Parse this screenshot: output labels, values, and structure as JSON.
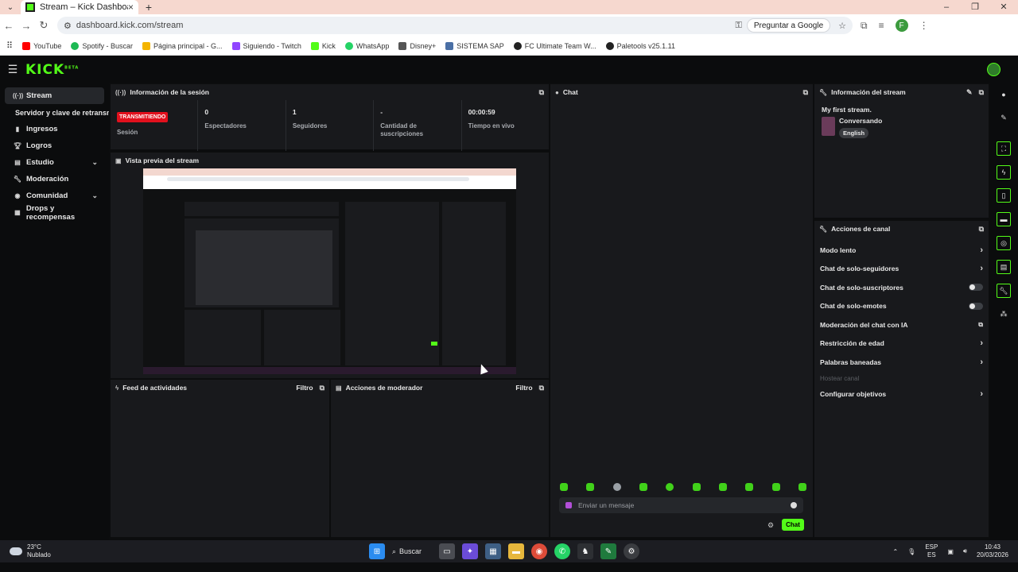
{
  "browser": {
    "tab_title": "Stream – Kick Dashboard",
    "url": "dashboard.kick.com/stream",
    "google_button": "Preguntar a Google",
    "profile_initial": "F",
    "bookmarks": [
      {
        "label": "YouTube",
        "color": "#ff0000"
      },
      {
        "label": "Spotify - Buscar",
        "color": "#1db954"
      },
      {
        "label": "Página principal - G...",
        "color": "#f4b400"
      },
      {
        "label": "Siguiendo - Twitch",
        "color": "#9146ff"
      },
      {
        "label": "Kick",
        "color": "#53fc18"
      },
      {
        "label": "WhatsApp",
        "color": "#25d366"
      },
      {
        "label": "Disney+",
        "color": "#555555"
      },
      {
        "label": "SISTEMA SAP",
        "color": "#4a6fa5"
      },
      {
        "label": "FC Ultimate Team W...",
        "color": "#222222"
      },
      {
        "label": "Paletools v25.1.11",
        "color": "#222222"
      }
    ]
  },
  "kick": {
    "logo": "KICK",
    "logo_beta": "BETA"
  },
  "sidebar": {
    "items": [
      {
        "label": "Stream",
        "icon": "stream-icon"
      },
      {
        "label": "Servidor y clave de retransmisión",
        "icon": ""
      },
      {
        "label": "Ingresos",
        "icon": "revenue-icon"
      },
      {
        "label": "Logros",
        "icon": "trophy-icon"
      },
      {
        "label": "Estudio",
        "icon": "studio-icon"
      },
      {
        "label": "Moderación",
        "icon": "wrench-icon"
      },
      {
        "label": "Comunidad",
        "icon": "community-icon"
      },
      {
        "label": "Drops y recompensas",
        "icon": "drops-icon"
      }
    ]
  },
  "session": {
    "title": "Información de la sesión",
    "badge": "TRANSMITIENDO",
    "badge_color": "#e1101d",
    "stats": [
      {
        "value": "",
        "label": "Sesión"
      },
      {
        "value": "0",
        "label": "Espectadores"
      },
      {
        "value": "1",
        "label": "Seguidores"
      },
      {
        "value": "-",
        "label": "Cantidad de suscripciones"
      },
      {
        "value": "00:00:59",
        "label": "Tiempo en vivo"
      }
    ]
  },
  "preview": {
    "title": "Vista previa del stream"
  },
  "feed": {
    "title": "Feed de actividades",
    "filter": "Filtro"
  },
  "modactions": {
    "title": "Acciones de moderador",
    "filter": "Filtro"
  },
  "chat": {
    "title": "Chat",
    "placeholder": "Enviar un mensaje",
    "send_label": "Chat",
    "accent": "#53fc18"
  },
  "stream_info": {
    "title": "Información del stream",
    "stream_title": "My first stream.",
    "category": "Conversando",
    "language": "English"
  },
  "channel_actions": {
    "title": "Acciones de canal",
    "items": [
      {
        "label": "Modo lento",
        "control": "chevron"
      },
      {
        "label": "Chat de solo-seguidores",
        "control": "chevron"
      },
      {
        "label": "Chat de solo-suscriptores",
        "control": "toggle"
      },
      {
        "label": "Chat de solo-emotes",
        "control": "toggle"
      },
      {
        "label": "Moderación del chat con IA",
        "control": "external"
      },
      {
        "label": "Restricción de edad",
        "control": "chevron"
      },
      {
        "label": "Palabras baneadas",
        "control": "chevron"
      },
      {
        "label": "Hostear canal",
        "control": "none"
      },
      {
        "label": "Configurar objetivos",
        "control": "chevron"
      }
    ]
  },
  "taskbar": {
    "temperature": "23°C",
    "weather": "Nublado",
    "search": "Buscar",
    "lang": "ESP",
    "region": "ES",
    "time": "10:43",
    "date": "20/03/2026"
  }
}
